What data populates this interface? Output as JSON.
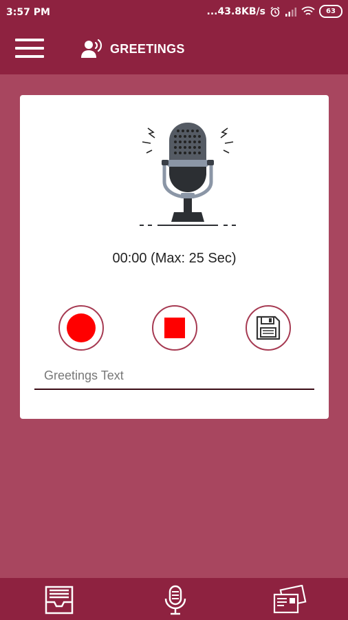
{
  "status_bar": {
    "time": "3:57 PM",
    "network_speed": "...43.8KB/s",
    "battery": "63"
  },
  "app_bar": {
    "title": "GREETINGS",
    "menu_icon": "hamburger-menu-icon",
    "title_icon": "speaking-person-icon"
  },
  "recorder": {
    "timer": "00:00 (Max: 25 Sec)",
    "record_icon": "record-icon",
    "stop_icon": "stop-icon",
    "save_icon": "floppy-save-icon",
    "text_placeholder": "Greetings Text"
  },
  "bottom_nav": {
    "items": [
      "inbox-tray-icon",
      "microphone-icon",
      "greeting-cards-icon"
    ]
  },
  "colors": {
    "primary": "#8e2240",
    "background": "#a8465f",
    "accent": "#ff0000"
  }
}
